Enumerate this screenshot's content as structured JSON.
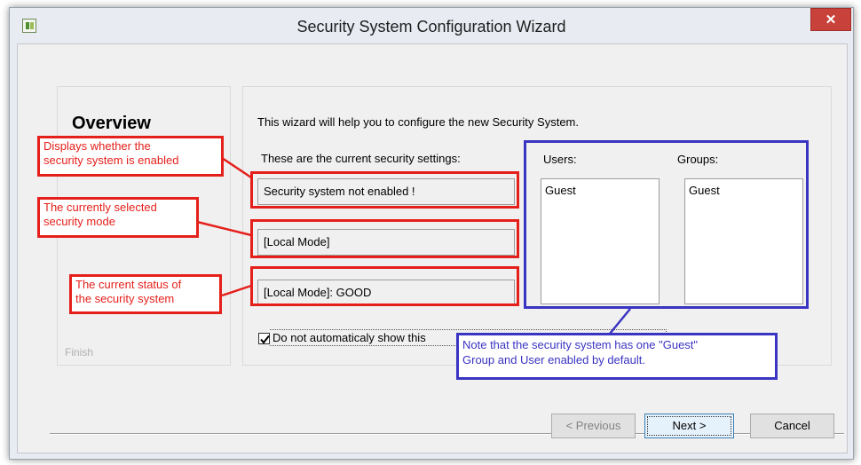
{
  "window": {
    "title": "Security System Configuration Wizard",
    "close_label": "✕"
  },
  "left_panel": {
    "overview_title": "Overview",
    "hidden_step_finish": "Finish"
  },
  "main_panel": {
    "intro_text": "This wizard will help you to configure the new Security System.",
    "current_settings_label": "These are the current security settings:",
    "enabled_field": "Security system not enabled !",
    "mode_field": "[Local Mode]",
    "status_field": "[Local Mode]: GOOD",
    "users_label": "Users:",
    "groups_label": "Groups:",
    "users_list": [
      "Guest"
    ],
    "groups_list": [
      "Guest"
    ],
    "checkbox_label": "Do not automaticaly show this",
    "checkbox_checked": true
  },
  "buttons": {
    "previous": "< Previous",
    "next": "Next >",
    "cancel": "Cancel"
  },
  "annotations": {
    "enabled_callout": [
      "Displays whether the",
      "security system is enabled"
    ],
    "mode_callout": [
      "The currently selected",
      "security mode"
    ],
    "status_callout": [
      "The current status of",
      "the security system"
    ],
    "guest_callout": [
      "Note that the security system has one \"Guest\"",
      "Group and User enabled by default."
    ]
  },
  "colors": {
    "callout_red": "#e5201b",
    "callout_blue": "#3a34c2",
    "close_button": "#c8413a"
  }
}
